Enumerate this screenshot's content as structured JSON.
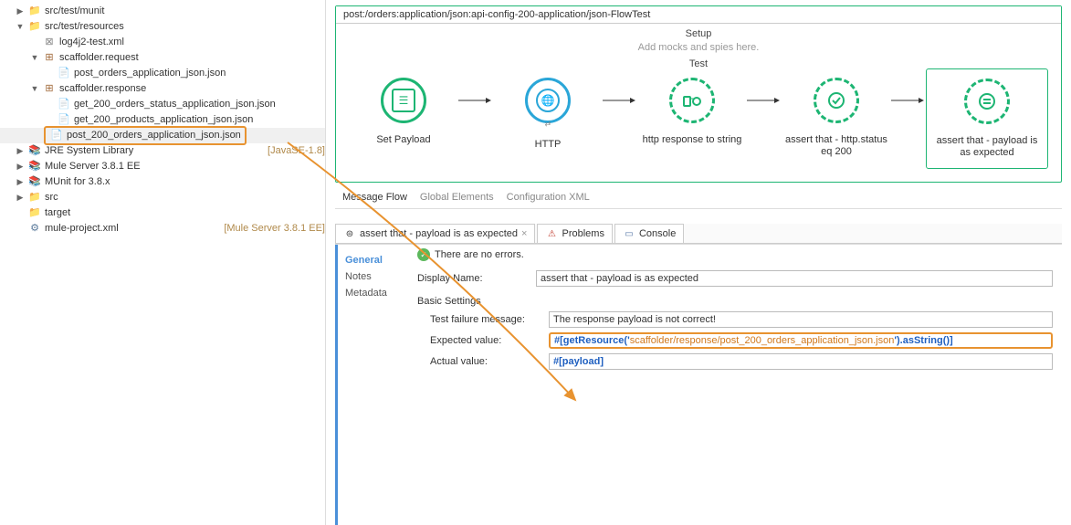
{
  "tree": {
    "munit": "src/test/munit",
    "resources": "src/test/resources",
    "log4j": "log4j2-test.xml",
    "scafreq": "scaffolder.request",
    "post_orders": "post_orders_application_json.json",
    "scafres": "scaffolder.response",
    "get_status": "get_200_orders_status_application_json.json",
    "get_products": "get_200_products_application_json.json",
    "post_200": "post_200_orders_application_json.json",
    "jre": "JRE System Library",
    "jre_decor": "[JavaSE-1.8]",
    "mule_server": "Mule Server 3.8.1 EE",
    "munit38": "MUnit for 3.8.x",
    "src": "src",
    "target": "target",
    "mule_project": "mule-project.xml",
    "mule_project_decor": "[Mule Server 3.8.1 EE]"
  },
  "flow": {
    "title": "post:/orders:application/json:api-config-200-application/json-FlowTest",
    "setup_label": "Setup",
    "setup_placeholder": "Add mocks and spies here.",
    "test_label": "Test",
    "nodes": {
      "set_payload": "Set Payload",
      "http": "HTTP",
      "http_resp": "http response to string",
      "assert_status": "assert that - http.status eq 200",
      "assert_payload": "assert that - payload is as expected"
    }
  },
  "editor_tabs": {
    "message_flow": "Message Flow",
    "global_elements": "Global Elements",
    "config_xml": "Configuration XML"
  },
  "bottom_tabs": {
    "assert_tab": "assert that - payload is as expected",
    "problems": "Problems",
    "console": "Console"
  },
  "properties": {
    "sidebar": {
      "general": "General",
      "notes": "Notes",
      "metadata": "Metadata"
    },
    "no_errors": "There are no errors.",
    "display_name_lbl": "Display Name:",
    "display_name": "assert that - payload is as expected",
    "basic_settings": "Basic Settings",
    "test_failure_lbl": "Test failure message:",
    "test_failure": "The response payload is not correct!",
    "expected_lbl": "Expected value:",
    "expected_pre": "#[getResource('",
    "expected_str": "scaffolder/response/post_200_orders_application_json.json",
    "expected_post": "').asString()]",
    "actual_lbl": "Actual value:",
    "actual_pre": "#[",
    "actual_var": "payload",
    "actual_post": "]"
  }
}
